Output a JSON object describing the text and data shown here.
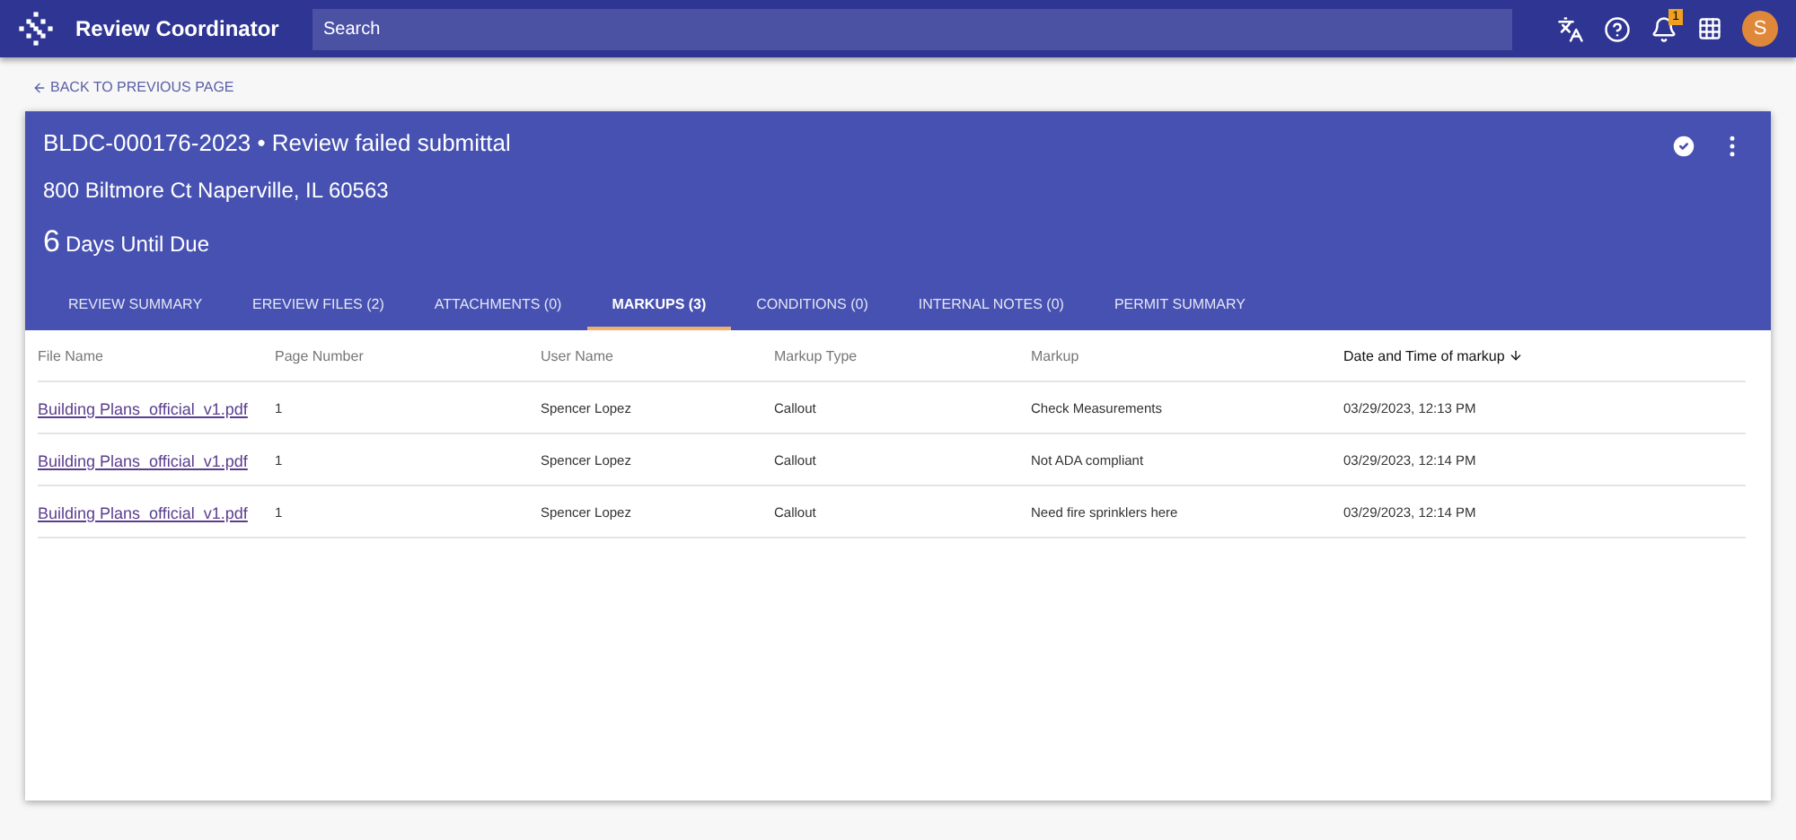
{
  "app_bar": {
    "title": "Review Coordinator",
    "search": {
      "placeholder": "Search"
    },
    "notification_count": "1",
    "avatar": "S"
  },
  "back_link": "BACK TO PREVIOUS PAGE",
  "record": {
    "title": "BLDC-000176-2023 • Review failed submittal",
    "address": "800 Biltmore Ct Naperville, IL 60563",
    "due_number": "6",
    "due_label": "Days Until Due"
  },
  "tabs": [
    {
      "label": "REVIEW SUMMARY",
      "selected": false
    },
    {
      "label": "EREVIEW FILES (2)",
      "selected": false
    },
    {
      "label": "ATTACHMENTS (0)",
      "selected": false
    },
    {
      "label": "MARKUPS (3)",
      "selected": true
    },
    {
      "label": "CONDITIONS (0)",
      "selected": false
    },
    {
      "label": "INTERNAL NOTES (0)",
      "selected": false
    },
    {
      "label": "PERMIT SUMMARY",
      "selected": false
    }
  ],
  "table": {
    "columns": [
      {
        "label": "File Name",
        "sorted": false
      },
      {
        "label": "Page Number",
        "sorted": false
      },
      {
        "label": "User Name",
        "sorted": false
      },
      {
        "label": "Markup Type",
        "sorted": false
      },
      {
        "label": "Markup",
        "sorted": false
      },
      {
        "label": "Date and Time of markup",
        "sorted": true
      }
    ],
    "rows": [
      [
        "Building Plans_official_v1.pdf",
        "1",
        "Spencer Lopez",
        "Callout",
        "Check Measurements",
        "03/29/2023, 12:13 PM"
      ],
      [
        "Building Plans_official_v1.pdf",
        "1",
        "Spencer Lopez",
        "Callout",
        "Not ADA compliant",
        "03/29/2023, 12:14 PM"
      ],
      [
        "Building Plans_official_v1.pdf",
        "1",
        "Spencer Lopez",
        "Callout",
        "Need fire sprinklers here",
        "03/29/2023, 12:14 PM"
      ]
    ]
  }
}
